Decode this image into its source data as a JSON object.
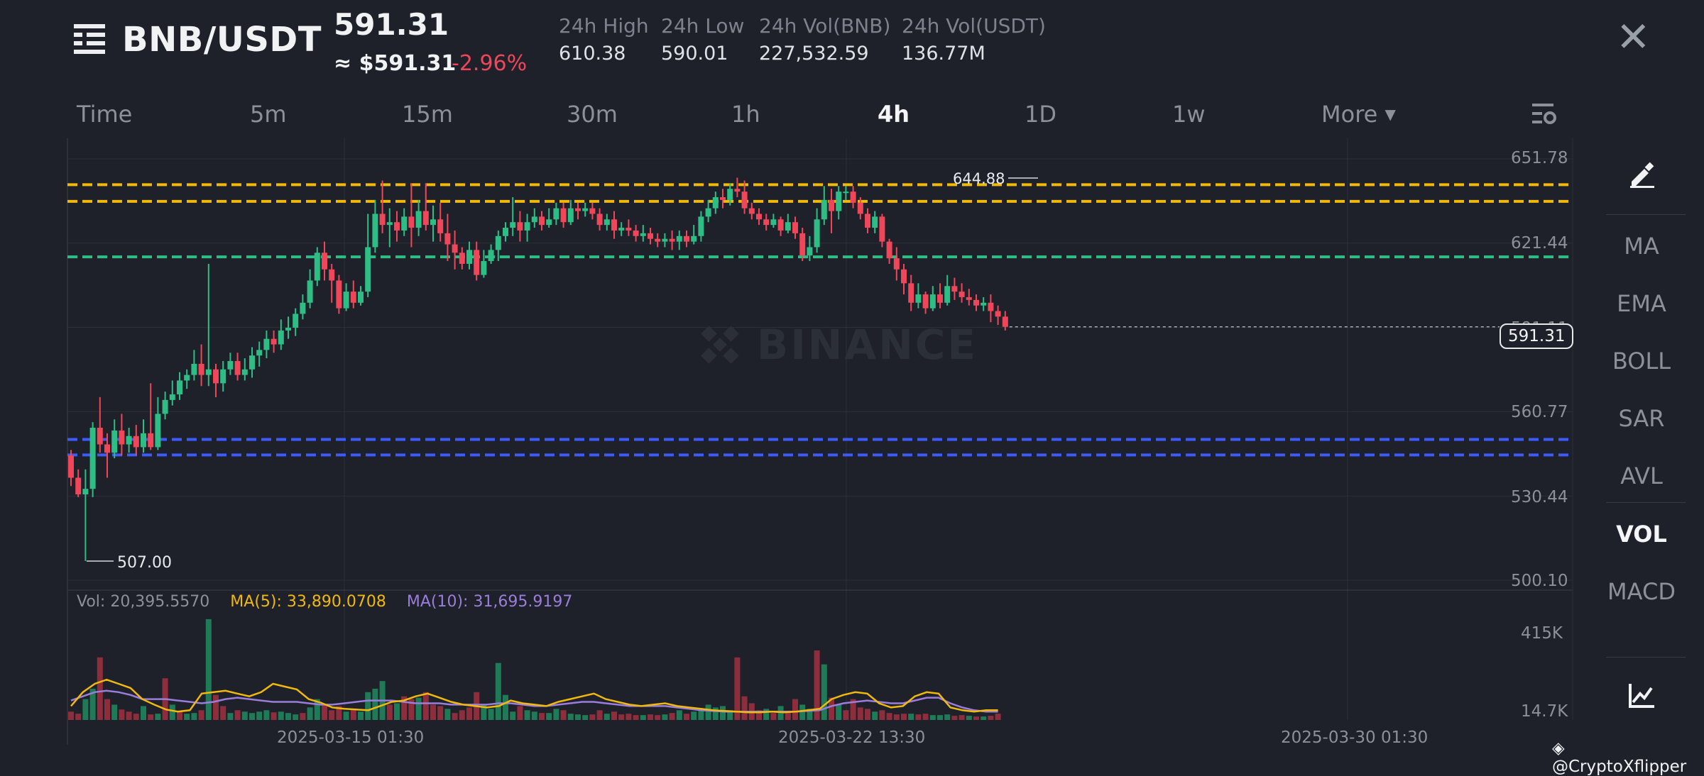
{
  "header": {
    "pair": "BNB/USDT",
    "last_price": "591.31",
    "usd_price": "≈ $591.31",
    "change": "-2.96%",
    "stats": [
      {
        "label": "24h High",
        "value": "610.38"
      },
      {
        "label": "24h Low",
        "value": "590.01"
      },
      {
        "label": "24h Vol(BNB)",
        "value": "227,532.59"
      },
      {
        "label": "24h Vol(USDT)",
        "value": "136.77M"
      }
    ]
  },
  "timeframes": [
    "Time",
    "5m",
    "15m",
    "30m",
    "1h",
    "4h",
    "1D",
    "1w",
    "More"
  ],
  "active_timeframe": "4h",
  "indicators": [
    "MA",
    "EMA",
    "BOLL",
    "SAR",
    "AVL",
    "VOL",
    "MACD"
  ],
  "active_indicator": "VOL",
  "watermark": "BINANCE",
  "volume_legend": {
    "vol": "Vol: 20,395.5570",
    "ma5": "MA(5): 33,890.0708",
    "ma10": "MA(10): 31,695.9197"
  },
  "credit": "@CryptoXflipper",
  "colors": {
    "up": "#2ebd85",
    "down": "#f0465a",
    "background": "#1e2129",
    "resistance": "#f0b90b",
    "support_mid": "#2ebd85",
    "support_low": "#3d5afe",
    "ma5": "#f0b90b",
    "ma10": "#9b7ddb"
  },
  "chart_data": {
    "type": "candlestick",
    "price_axis": [
      "651.78",
      "621.44",
      "591.11",
      "560.77",
      "530.44",
      "500.10"
    ],
    "volume_axis": [
      "415K",
      "14.7K"
    ],
    "date_labels": [
      "2025-03-15 01:30",
      "2025-03-22 13:30",
      "2025-03-30 01:30"
    ],
    "high_marker": "644.88",
    "low_marker": "507.00",
    "current_price": "591.31",
    "ylim": [
      500.1,
      651.78
    ],
    "horizontal_levels": [
      {
        "value": 642.5,
        "color": "#f0b90b",
        "style": "dashed"
      },
      {
        "value": 636.5,
        "color": "#f0b90b",
        "style": "dashed"
      },
      {
        "value": 616.5,
        "color": "#2ebd85",
        "style": "dashed"
      },
      {
        "value": 550.8,
        "color": "#3d5afe",
        "style": "dashed"
      },
      {
        "value": 545.2,
        "color": "#3d5afe",
        "style": "dashed"
      }
    ],
    "candles": [
      [
        545,
        537,
        547,
        534
      ],
      [
        537,
        531,
        540,
        530
      ],
      [
        531,
        533,
        540,
        507
      ],
      [
        533,
        555,
        557,
        530
      ],
      [
        555,
        549,
        566,
        546
      ],
      [
        549,
        546,
        553,
        537
      ],
      [
        546,
        554,
        558,
        544
      ],
      [
        554,
        549,
        560,
        545
      ],
      [
        549,
        552,
        555,
        546
      ],
      [
        552,
        548,
        556,
        545
      ],
      [
        548,
        553,
        558,
        546
      ],
      [
        553,
        548,
        571,
        547
      ],
      [
        548,
        560,
        566,
        547
      ],
      [
        560,
        565,
        568,
        558
      ],
      [
        565,
        567,
        572,
        563
      ],
      [
        567,
        572,
        575,
        565
      ],
      [
        572,
        574,
        576,
        569
      ],
      [
        574,
        578,
        583,
        572
      ],
      [
        578,
        574,
        585,
        570
      ],
      [
        574,
        576,
        614,
        570
      ],
      [
        576,
        571,
        578,
        566
      ],
      [
        571,
        576,
        579,
        568
      ],
      [
        576,
        579,
        582,
        574
      ],
      [
        579,
        574,
        582,
        572
      ],
      [
        574,
        576,
        580,
        572
      ],
      [
        576,
        581,
        584,
        573
      ],
      [
        581,
        583,
        586,
        577
      ],
      [
        583,
        587,
        590,
        580
      ],
      [
        587,
        585,
        590,
        582
      ],
      [
        585,
        590,
        594,
        583
      ],
      [
        590,
        591,
        595,
        587
      ],
      [
        591,
        596,
        598,
        588
      ],
      [
        596,
        600,
        603,
        594
      ],
      [
        600,
        608,
        612,
        598
      ],
      [
        608,
        618,
        620,
        606
      ],
      [
        618,
        612,
        622,
        608
      ],
      [
        612,
        608,
        614,
        600
      ],
      [
        608,
        598,
        610,
        596
      ],
      [
        598,
        604,
        607,
        597
      ],
      [
        604,
        600,
        608,
        598
      ],
      [
        600,
        604,
        606,
        599
      ],
      [
        604,
        620,
        632,
        602
      ],
      [
        620,
        632,
        637,
        618
      ],
      [
        632,
        628,
        644,
        625
      ],
      [
        628,
        629,
        634,
        620
      ],
      [
        629,
        626,
        633,
        622
      ],
      [
        626,
        631,
        634,
        624
      ],
      [
        631,
        627,
        643,
        620
      ],
      [
        627,
        633,
        637,
        624
      ],
      [
        633,
        628,
        643,
        626
      ],
      [
        628,
        630,
        635,
        622
      ],
      [
        630,
        625,
        636,
        622
      ],
      [
        625,
        621,
        632,
        615
      ],
      [
        621,
        618,
        626,
        612
      ],
      [
        618,
        614,
        620,
        612
      ],
      [
        614,
        619,
        622,
        612
      ],
      [
        619,
        610,
        622,
        608
      ],
      [
        610,
        615,
        619,
        609
      ],
      [
        615,
        619,
        621,
        614
      ],
      [
        619,
        624,
        626,
        615
      ],
      [
        624,
        627,
        629,
        622
      ],
      [
        627,
        629,
        638,
        624
      ],
      [
        629,
        626,
        633,
        622
      ],
      [
        626,
        629,
        632,
        622
      ],
      [
        629,
        631,
        634,
        627
      ],
      [
        631,
        628,
        633,
        626
      ],
      [
        628,
        630,
        634,
        627
      ],
      [
        630,
        634,
        636,
        628
      ],
      [
        634,
        629,
        636,
        627
      ],
      [
        629,
        634,
        637,
        628
      ],
      [
        634,
        633,
        636,
        630
      ],
      [
        633,
        634,
        636,
        631
      ],
      [
        634,
        632,
        636,
        630
      ],
      [
        632,
        628,
        634,
        626
      ],
      [
        628,
        630,
        632,
        626
      ],
      [
        630,
        626,
        633,
        623
      ],
      [
        626,
        627,
        629,
        624
      ],
      [
        627,
        626,
        630,
        624
      ],
      [
        626,
        624,
        628,
        622
      ],
      [
        624,
        625,
        628,
        622
      ],
      [
        625,
        623,
        627,
        621
      ],
      [
        623,
        622,
        625,
        620
      ],
      [
        622,
        623,
        625,
        620
      ],
      [
        623,
        622,
        626,
        619
      ],
      [
        622,
        624,
        626,
        619
      ],
      [
        624,
        622,
        626,
        620
      ],
      [
        622,
        624,
        628,
        621
      ],
      [
        624,
        631,
        633,
        622
      ],
      [
        631,
        634,
        637,
        629
      ],
      [
        634,
        638,
        640,
        632
      ],
      [
        638,
        637,
        641,
        634
      ],
      [
        637,
        641,
        643,
        635
      ],
      [
        641,
        640,
        645,
        638
      ],
      [
        640,
        634,
        644,
        632
      ],
      [
        634,
        632,
        636,
        630
      ],
      [
        632,
        630,
        634,
        628
      ],
      [
        630,
        628,
        632,
        626
      ],
      [
        628,
        630,
        632,
        627
      ],
      [
        630,
        626,
        631,
        624
      ],
      [
        626,
        629,
        632,
        625
      ],
      [
        629,
        625,
        631,
        623
      ],
      [
        625,
        617,
        627,
        615
      ],
      [
        617,
        620,
        624,
        615
      ],
      [
        620,
        630,
        634,
        618
      ],
      [
        630,
        637,
        642,
        628
      ],
      [
        637,
        633,
        641,
        625
      ],
      [
        633,
        640,
        642,
        630
      ],
      [
        640,
        640,
        642,
        637
      ],
      [
        640,
        636,
        642,
        634
      ],
      [
        636,
        632,
        638,
        630
      ],
      [
        632,
        627,
        634,
        625
      ],
      [
        627,
        631,
        633,
        625
      ],
      [
        631,
        622,
        632,
        620
      ],
      [
        622,
        616,
        623,
        614
      ],
      [
        616,
        612,
        620,
        608
      ],
      [
        612,
        607,
        614,
        603
      ],
      [
        607,
        600,
        610,
        597
      ],
      [
        600,
        603,
        607,
        598
      ],
      [
        603,
        598,
        604,
        596
      ],
      [
        598,
        603,
        606,
        597
      ],
      [
        603,
        600,
        607,
        598
      ],
      [
        600,
        606,
        610,
        599
      ],
      [
        606,
        604,
        609,
        601
      ],
      [
        604,
        602,
        607,
        600
      ],
      [
        602,
        601,
        605,
        599
      ],
      [
        601,
        599,
        603,
        597
      ],
      [
        599,
        600,
        602,
        597
      ],
      [
        600,
        597,
        603,
        593
      ],
      [
        597,
        595,
        599,
        592
      ],
      [
        595,
        591.31,
        597,
        590
      ]
    ],
    "volume": [
      [
        12,
        0
      ],
      [
        9,
        0
      ],
      [
        30,
        1
      ],
      [
        45,
        1
      ],
      [
        90,
        0
      ],
      [
        30,
        0
      ],
      [
        22,
        1
      ],
      [
        15,
        0
      ],
      [
        12,
        0
      ],
      [
        9,
        0
      ],
      [
        20,
        1
      ],
      [
        8,
        0
      ],
      [
        9,
        1
      ],
      [
        60,
        0
      ],
      [
        22,
        1
      ],
      [
        12,
        0
      ],
      [
        9,
        1
      ],
      [
        10,
        1
      ],
      [
        14,
        0
      ],
      [
        145,
        1
      ],
      [
        36,
        0
      ],
      [
        20,
        0
      ],
      [
        10,
        1
      ],
      [
        14,
        0
      ],
      [
        12,
        1
      ],
      [
        10,
        1
      ],
      [
        12,
        1
      ],
      [
        14,
        1
      ],
      [
        11,
        0
      ],
      [
        12,
        1
      ],
      [
        10,
        1
      ],
      [
        8,
        1
      ],
      [
        10,
        0
      ],
      [
        18,
        1
      ],
      [
        30,
        1
      ],
      [
        22,
        0
      ],
      [
        14,
        0
      ],
      [
        20,
        0
      ],
      [
        12,
        1
      ],
      [
        16,
        0
      ],
      [
        12,
        1
      ],
      [
        40,
        1
      ],
      [
        45,
        1
      ],
      [
        56,
        1
      ],
      [
        22,
        0
      ],
      [
        24,
        1
      ],
      [
        34,
        0
      ],
      [
        30,
        0
      ],
      [
        32,
        1
      ],
      [
        40,
        0
      ],
      [
        22,
        0
      ],
      [
        20,
        0
      ],
      [
        16,
        1
      ],
      [
        10,
        0
      ],
      [
        14,
        0
      ],
      [
        18,
        0
      ],
      [
        40,
        0
      ],
      [
        22,
        1
      ],
      [
        16,
        1
      ],
      [
        82,
        1
      ],
      [
        36,
        1
      ],
      [
        12,
        1
      ],
      [
        20,
        0
      ],
      [
        14,
        1
      ],
      [
        12,
        1
      ],
      [
        10,
        0
      ],
      [
        10,
        1
      ],
      [
        16,
        1
      ],
      [
        14,
        0
      ],
      [
        9,
        1
      ],
      [
        8,
        1
      ],
      [
        7,
        1
      ],
      [
        8,
        0
      ],
      [
        14,
        0
      ],
      [
        9,
        1
      ],
      [
        12,
        0
      ],
      [
        8,
        0
      ],
      [
        9,
        0
      ],
      [
        7,
        0
      ],
      [
        7,
        1
      ],
      [
        8,
        0
      ],
      [
        7,
        0
      ],
      [
        8,
        1
      ],
      [
        10,
        0
      ],
      [
        14,
        1
      ],
      [
        9,
        0
      ],
      [
        12,
        1
      ],
      [
        14,
        1
      ],
      [
        22,
        1
      ],
      [
        18,
        1
      ],
      [
        20,
        1
      ],
      [
        14,
        1
      ],
      [
        90,
        0
      ],
      [
        34,
        0
      ],
      [
        24,
        0
      ],
      [
        14,
        0
      ],
      [
        16,
        1
      ],
      [
        10,
        0
      ],
      [
        20,
        1
      ],
      [
        12,
        0
      ],
      [
        30,
        0
      ],
      [
        22,
        1
      ],
      [
        16,
        1
      ],
      [
        100,
        0
      ],
      [
        80,
        1
      ],
      [
        32,
        0
      ],
      [
        22,
        1
      ],
      [
        14,
        0
      ],
      [
        30,
        0
      ],
      [
        18,
        0
      ],
      [
        16,
        0
      ],
      [
        12,
        1
      ],
      [
        14,
        0
      ],
      [
        10,
        0
      ],
      [
        8,
        0
      ],
      [
        9,
        0
      ],
      [
        9,
        1
      ],
      [
        8,
        0
      ],
      [
        9,
        0
      ],
      [
        7,
        1
      ],
      [
        7,
        1
      ],
      [
        8,
        1
      ],
      [
        6,
        0
      ],
      [
        7,
        0
      ],
      [
        6,
        1
      ],
      [
        5,
        0
      ],
      [
        5,
        1
      ],
      [
        6,
        0
      ],
      [
        9,
        0
      ]
    ],
    "ma5": [
      20,
      40,
      52,
      58,
      52,
      46,
      30,
      22,
      15,
      12,
      14,
      38,
      40,
      42,
      38,
      34,
      40,
      52,
      48,
      44,
      30,
      25,
      18,
      16,
      15,
      14,
      20,
      26,
      28,
      34,
      38,
      32,
      26,
      22,
      20,
      18,
      20,
      28,
      24,
      22,
      20,
      26,
      30,
      34,
      38,
      30,
      26,
      22,
      20,
      22,
      24,
      20,
      18,
      16,
      14,
      13,
      12,
      11,
      11,
      12,
      11,
      12,
      14,
      16,
      30,
      36,
      40,
      38,
      24,
      18,
      20,
      34,
      40,
      38,
      18,
      14,
      12,
      14,
      14
    ],
    "ma10": [
      28,
      34,
      40,
      42,
      40,
      36,
      30,
      30,
      30,
      28,
      26,
      24,
      26,
      30,
      32,
      30,
      28,
      26,
      26,
      26,
      24,
      22,
      22,
      24,
      26,
      28,
      28,
      28,
      26,
      24,
      24,
      24,
      22,
      22,
      22,
      22,
      24,
      24,
      22,
      20,
      20,
      22,
      24,
      26,
      26,
      24,
      22,
      20,
      20,
      20,
      20,
      18,
      16,
      14,
      13,
      12,
      12,
      12,
      12,
      12,
      12,
      12,
      13,
      14,
      20,
      24,
      26,
      28,
      26,
      24,
      24,
      28,
      32,
      32,
      24,
      18,
      14,
      12,
      12
    ]
  }
}
